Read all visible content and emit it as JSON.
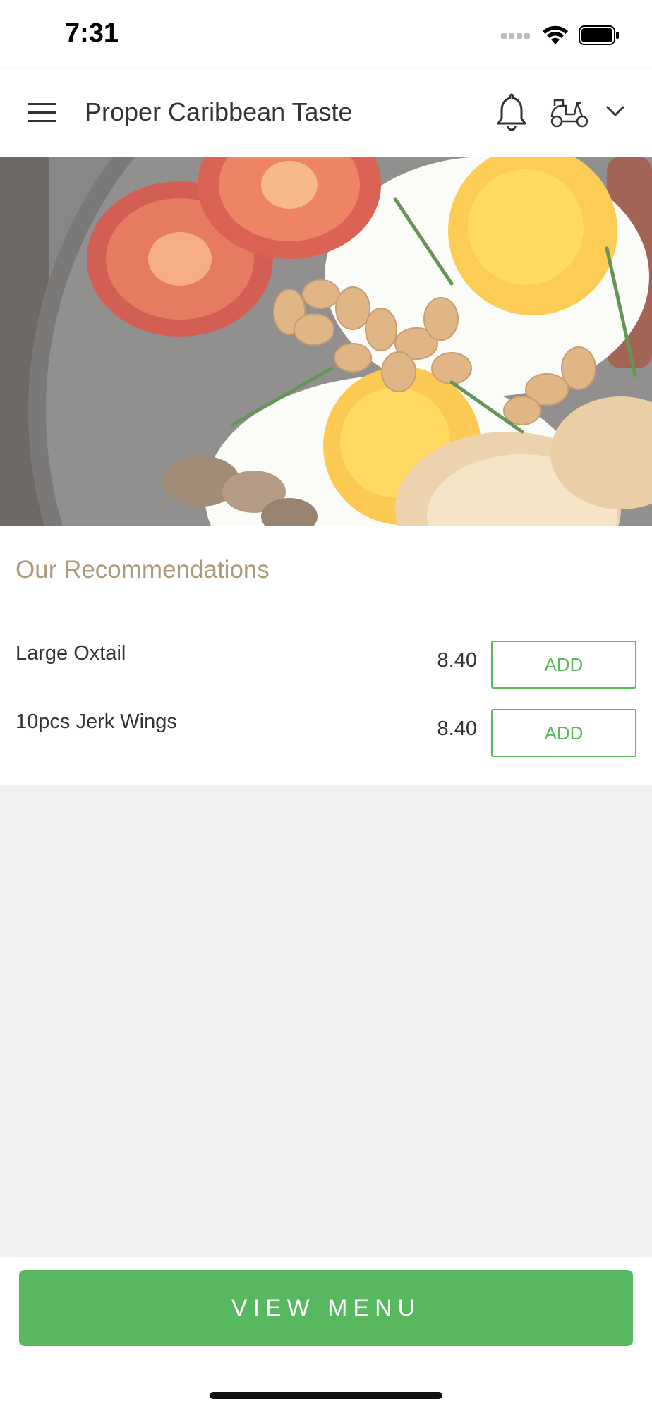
{
  "status_bar": {
    "time": "7:31"
  },
  "header": {
    "title": "Proper Caribbean Taste",
    "icons": [
      "hamburger-menu-icon",
      "bell-icon",
      "scooter-icon",
      "chevron-down-icon"
    ]
  },
  "hero": {
    "icon": "breakfast-food-photo"
  },
  "recommendations": {
    "title": "Our Recommendations",
    "items": [
      {
        "name": "Large Oxtail",
        "price": "8.40",
        "button": "ADD"
      },
      {
        "name": "10pcs Jerk Wings",
        "price": "8.40",
        "button": "ADD"
      }
    ]
  },
  "footer": {
    "view_menu_label": "VIEW MENU"
  },
  "colors": {
    "accent_green": "#57b860",
    "section_title": "#ad9a7d",
    "background": "#f1f1f1"
  }
}
